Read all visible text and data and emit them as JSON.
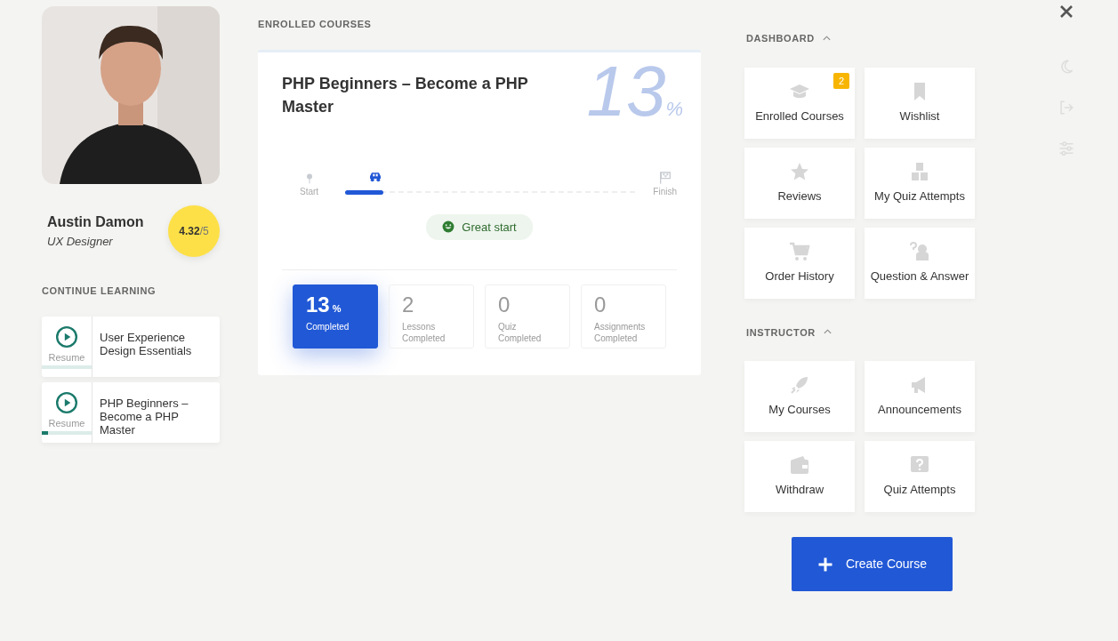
{
  "profile": {
    "name": "Austin Damon",
    "role": "UX Designer",
    "rating": "4.32",
    "rating_max": "/5"
  },
  "continue_learning": {
    "title": "CONTINUE LEARNING",
    "items": [
      {
        "title": "User Experience Design Essentials",
        "action": "Resume",
        "level": 0
      },
      {
        "title": "PHP Beginners – Become a PHP Master",
        "action": "Resume",
        "level": 0.12
      }
    ]
  },
  "enrolled": {
    "heading": "ENROLLED COURSES",
    "course_title": "PHP Beginners – Become a PHP Master",
    "big_percent": "13",
    "percent_sign": "%",
    "progress": {
      "start": "Start",
      "finish": "Finish",
      "level": 0.13
    },
    "message": "Great start",
    "stats": [
      {
        "value": "13",
        "unit": "%",
        "label": "Completed",
        "selected": true
      },
      {
        "value": "2",
        "label": "Lessons Completed",
        "selected": false
      },
      {
        "value": "0",
        "label": "Quiz Completed",
        "selected": false
      },
      {
        "value": "0",
        "label": "Assignments Completed",
        "selected": false
      }
    ]
  },
  "sections": [
    {
      "title": "DASHBOARD",
      "expanded": true,
      "items": [
        {
          "label": "Enrolled Courses",
          "kind": "cap",
          "badge": "2"
        },
        {
          "label": "Wishlist",
          "kind": "bookmark"
        },
        {
          "label": "Reviews",
          "kind": "star"
        },
        {
          "label": "My Quiz Attempts",
          "kind": "blocks"
        },
        {
          "label": "Order History",
          "kind": "cart"
        },
        {
          "label": "Question & Answer",
          "kind": "qa"
        }
      ]
    },
    {
      "title": "INSTRUCTOR",
      "expanded": true,
      "items": [
        {
          "label": "My Courses",
          "kind": "rocket"
        },
        {
          "label": "Announcements",
          "kind": "megaphone"
        },
        {
          "label": "Withdraw",
          "kind": "wallet"
        },
        {
          "label": "Quiz Attempts",
          "kind": "question"
        }
      ]
    }
  ],
  "create_button": {
    "label": "Create Course"
  }
}
